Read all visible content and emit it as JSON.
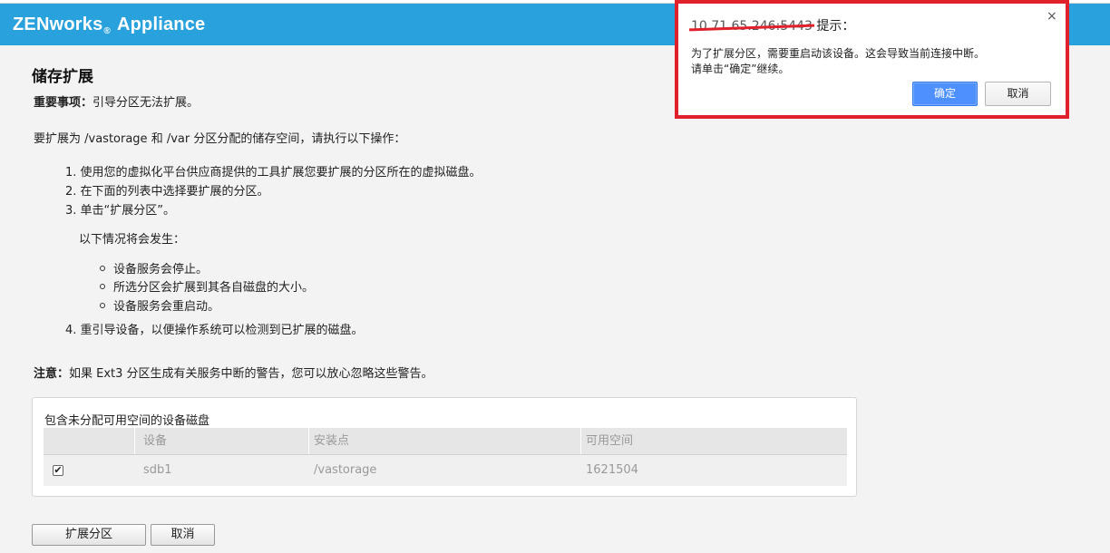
{
  "header": {
    "brand_main": "ZENworks",
    "brand_reg": "®",
    "brand_tail": " Appliance"
  },
  "page": {
    "title": "储存扩展",
    "important_label": "重要事项：",
    "important_text": "引导分区无法扩展。",
    "intro": "要扩展为 /vastorage 和 /var 分区分配的储存空间，请执行以下操作：",
    "steps": [
      "1. 使用您的虚拟化平台供应商提供的工具扩展您要扩展的分区所在的虚拟磁盘。",
      "2. 在下面的列表中选择要扩展的分区。",
      "3. 单击“扩展分区”。"
    ],
    "sub_intro": "以下情况将会发生：",
    "bullets": [
      "设备服务会停止。",
      "所选分区会扩展到其各自磁盘的大小。",
      "设备服务会重启动。"
    ],
    "step4": "4. 重引导设备，以便操作系统可以检测到已扩展的磁盘。",
    "note_label": "注意：",
    "note_text": "如果 Ext3 分区生成有关服务中断的警告，您可以放心忽略这些警告。"
  },
  "disk_panel": {
    "title": "包含未分配可用空间的设备磁盘",
    "columns": [
      "设备",
      "安装点",
      "可用空间"
    ],
    "rows": [
      {
        "checked": "✔",
        "device": "sdb1",
        "mount": "/vastorage",
        "free": "1621504"
      }
    ]
  },
  "actions": {
    "expand_label": "扩展分区",
    "cancel_label": "取消"
  },
  "dialog": {
    "host": "10.71.65.246:5443",
    "title_suffix": " 提示：",
    "close": "×",
    "message_line1": "为了扩展分区，需要重启动该设备。这会导致当前连接中断。",
    "message_line2": "请单击“确定”继续。",
    "ok_label": "确定",
    "cancel_label": "取消"
  },
  "colors": {
    "header": "#29a1dc",
    "highlight_border": "#e0202a",
    "ok_button": "#4d90fe"
  }
}
